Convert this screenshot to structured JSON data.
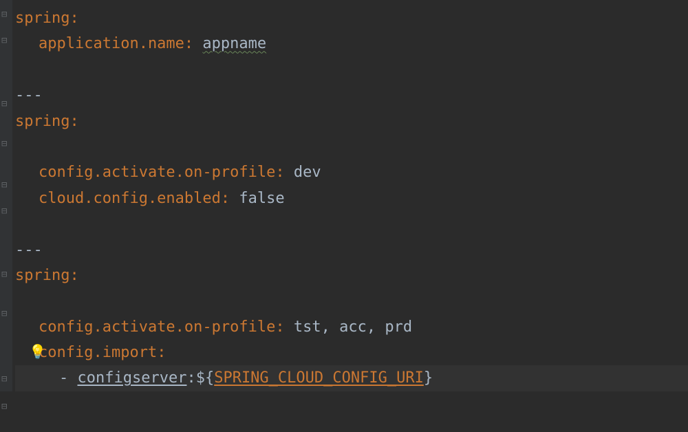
{
  "doc1": {
    "key_spring": "spring",
    "key_app_name": "application.name",
    "val_app_name": "appname"
  },
  "separator": "---",
  "doc2": {
    "key_spring": "spring",
    "key_config_profile": "config.activate.on-profile",
    "val_config_profile": "dev",
    "key_cloud_enabled": "cloud.config.enabled",
    "val_cloud_enabled": "false"
  },
  "doc3": {
    "key_spring": "spring",
    "key_config_profile": "config.activate.on-profile",
    "val_config_profile": "tst, acc, prd",
    "key_config_import": "config.import",
    "list_dash": "- ",
    "val_configserver_prefix": "configserver",
    "val_dollar_open": ":${",
    "val_env_var": "SPRING_CLOUD_CONFIG_URI",
    "val_close": "}"
  }
}
